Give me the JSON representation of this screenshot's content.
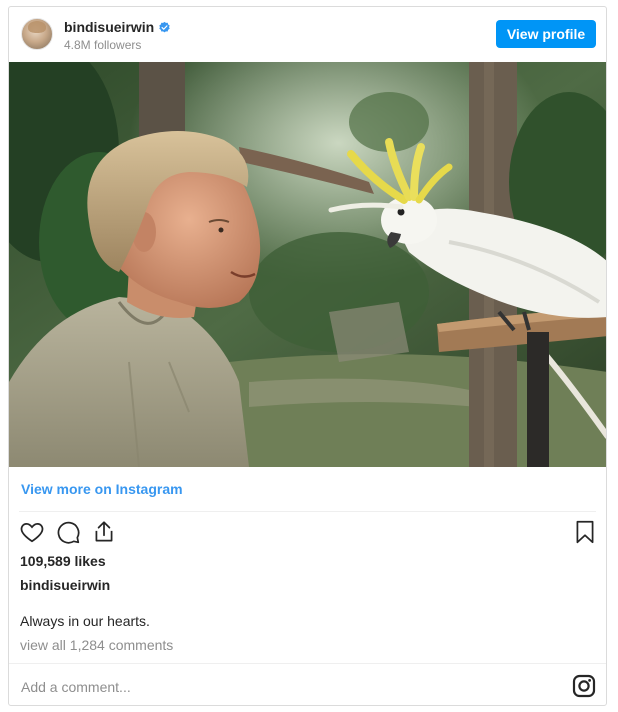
{
  "header": {
    "username": "bindisueirwin",
    "followers": "4.8M followers",
    "view_profile_label": "View profile",
    "verified_icon": "verified-badge-icon",
    "accent_color": "#0095f6"
  },
  "post": {
    "view_more_label": "View more on Instagram",
    "likes": "109,589 likes",
    "owner": "bindisueirwin",
    "caption": "Always in our hearts.",
    "comments_link": "view all 1,284 comments",
    "comment_placeholder": "Add a comment...",
    "link_color": "#3897f0"
  },
  "icons": {
    "like": "heart-icon",
    "comment": "comment-bubble-icon",
    "share": "share-upload-icon",
    "save": "bookmark-icon",
    "instagram": "instagram-logo-icon"
  }
}
